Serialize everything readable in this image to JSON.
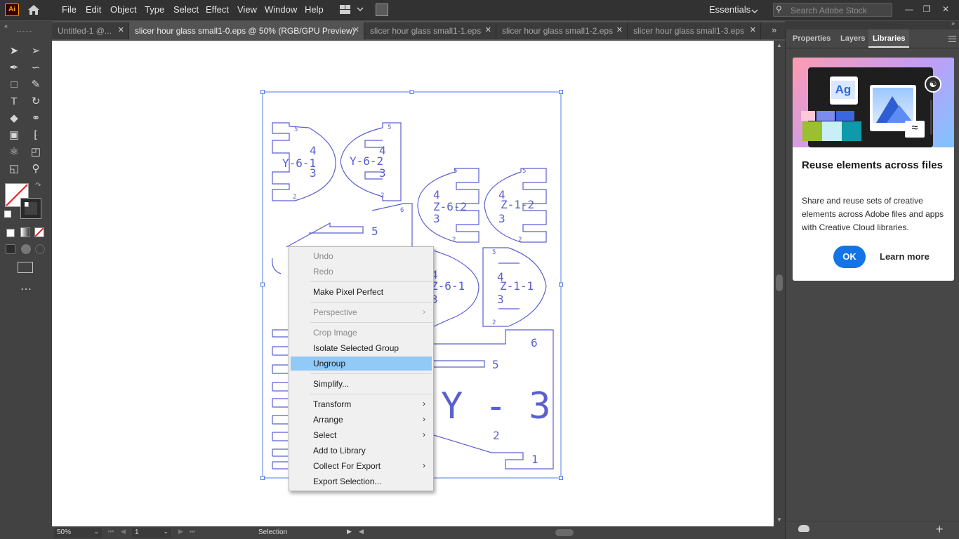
{
  "app": {
    "logo": "Ai"
  },
  "menu": [
    "File",
    "Edit",
    "Object",
    "Type",
    "Select",
    "Effect",
    "View",
    "Window",
    "Help"
  ],
  "workspace": "Essentials",
  "search": {
    "placeholder": "Search Adobe Stock"
  },
  "tabs": [
    {
      "label": "Untitled-1 @...",
      "active": false
    },
    {
      "label": "slicer hour glass small1-0.eps @ 50% (RGB/GPU Preview)",
      "active": true
    },
    {
      "label": "slicer hour glass small1-1.eps",
      "active": false
    },
    {
      "label": "slicer hour glass small1-2.eps",
      "active": false
    },
    {
      "label": "slicer hour glass small1-3.eps",
      "active": false
    }
  ],
  "panel": {
    "tabs": [
      "Properties",
      "Layers",
      "Libraries"
    ],
    "active_tab": "Libraries",
    "card": {
      "title": "Reuse elements across files",
      "body": "Share and reuse sets of creative elements across Adobe files and apps with Creative Cloud libraries.",
      "ok": "OK",
      "learn": "Learn more",
      "thumb_text": "Ag"
    }
  },
  "context_menu": {
    "items": [
      {
        "label": "Undo",
        "disabled": true
      },
      {
        "label": "Redo",
        "disabled": true
      },
      {
        "label": "Make Pixel Perfect",
        "disabled": false
      },
      {
        "label": "Perspective",
        "disabled": true,
        "submenu": true
      },
      {
        "label": "Crop Image",
        "disabled": true
      },
      {
        "label": "Isolate Selected Group",
        "disabled": false
      },
      {
        "label": "Ungroup",
        "disabled": false,
        "highlighted": true
      },
      {
        "label": "Simplify...",
        "disabled": false
      },
      {
        "label": "Transform",
        "disabled": false,
        "submenu": true
      },
      {
        "label": "Arrange",
        "disabled": false,
        "submenu": true
      },
      {
        "label": "Select",
        "disabled": false,
        "submenu": true
      },
      {
        "label": "Add to Library",
        "disabled": false
      },
      {
        "label": "Collect For Export",
        "disabled": false,
        "submenu": true
      },
      {
        "label": "Export Selection...",
        "disabled": false
      }
    ]
  },
  "artwork_labels": {
    "y61": "Y-6-1",
    "y62": "Y-6-2",
    "z62": "Z-6-2",
    "z12": "Z-1-2",
    "z61": "Z-6-1",
    "z11": "Z-1-1",
    "y3": "Y - 3",
    "n1": "1",
    "n2": "2",
    "n3": "3",
    "n4": "4",
    "n5": "5",
    "n6": "6"
  },
  "status": {
    "zoom": "50%",
    "page": "1",
    "tool": "Selection"
  },
  "colors": {
    "accent": "#1473e6",
    "selection": "#4f7be8",
    "artwork": "#5a5fd0",
    "highlight": "#91c9f7"
  }
}
